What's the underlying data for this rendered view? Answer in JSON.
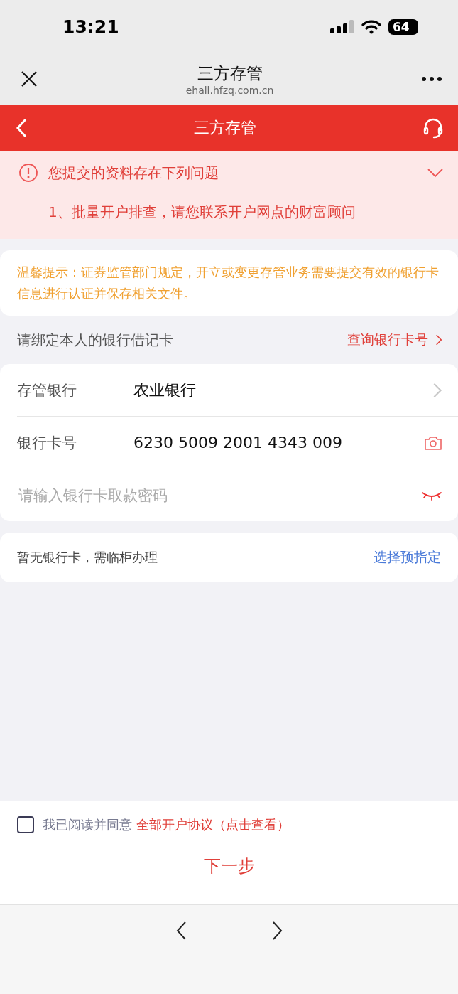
{
  "status_bar": {
    "time": "13:21",
    "battery": "64"
  },
  "browser_bar": {
    "title": "三方存管",
    "url": "ehall.hfzq.com.cn"
  },
  "header": {
    "title": "三方存管"
  },
  "error_panel": {
    "title": "您提交的资料存在下列问题",
    "items": [
      "1、批量开户排查，请您联系开户网点的财富顾问"
    ]
  },
  "tip": "温馨提示：证券监管部门规定，开立或变更存管业务需要提交有效的银行卡信息进行认证并保存相关文件。",
  "bind": {
    "label": "请绑定本人的银行借记卡",
    "link": "查询银行卡号"
  },
  "form_rows": [
    {
      "kind": "select",
      "label": "存管银行",
      "value": "农业银行"
    },
    {
      "kind": "card",
      "label": "银行卡号",
      "value": "6230 5009 2001 4343 009"
    },
    {
      "kind": "password",
      "placeholder": "请输入银行卡取款密码"
    }
  ],
  "no_card": {
    "text": "暂无银行卡，需临柜办理",
    "link": "选择预指定"
  },
  "agreement": {
    "checked": false,
    "prefix": "我已阅读并同意",
    "link": "全部开户协议（点击查看）"
  },
  "next_button": "下一步"
}
